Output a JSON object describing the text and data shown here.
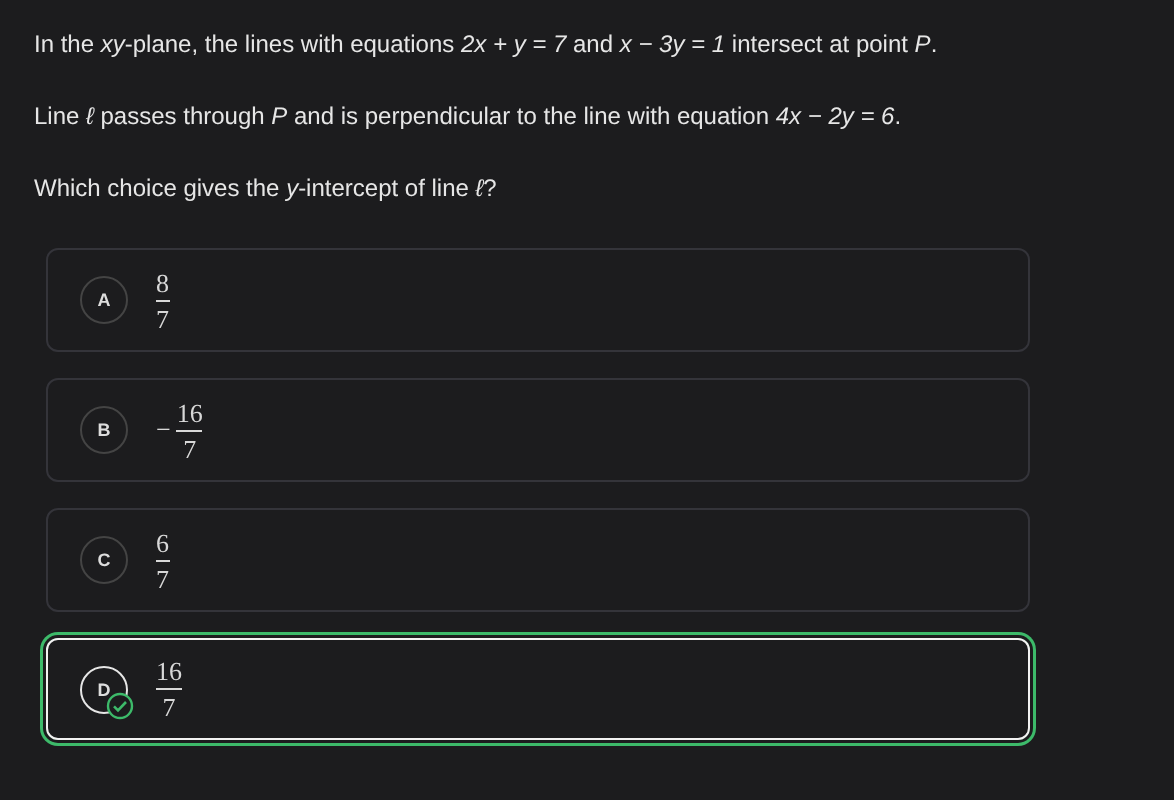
{
  "question": {
    "paragraphs": [
      "In the *xy*-plane, the lines with equations *2x + y = 7* and *x − 3y = 1* intersect at point *P*.",
      "Line *ℓ* passes through *P* and is perpendicular to the line with equation *4x − 2y = 6*.",
      "Which choice gives the *y*-intercept of line *ℓ*?"
    ]
  },
  "choices": [
    {
      "letter": "A",
      "numerator": "8",
      "denominator": "7",
      "selected": false,
      "correct": false
    },
    {
      "letter": "B",
      "sign": "−",
      "numerator": "16",
      "denominator": "7",
      "selected": false,
      "correct": false
    },
    {
      "letter": "C",
      "numerator": "6",
      "denominator": "7",
      "selected": false,
      "correct": false
    },
    {
      "letter": "D",
      "numerator": "16",
      "denominator": "7",
      "selected": true,
      "correct": true
    }
  ]
}
